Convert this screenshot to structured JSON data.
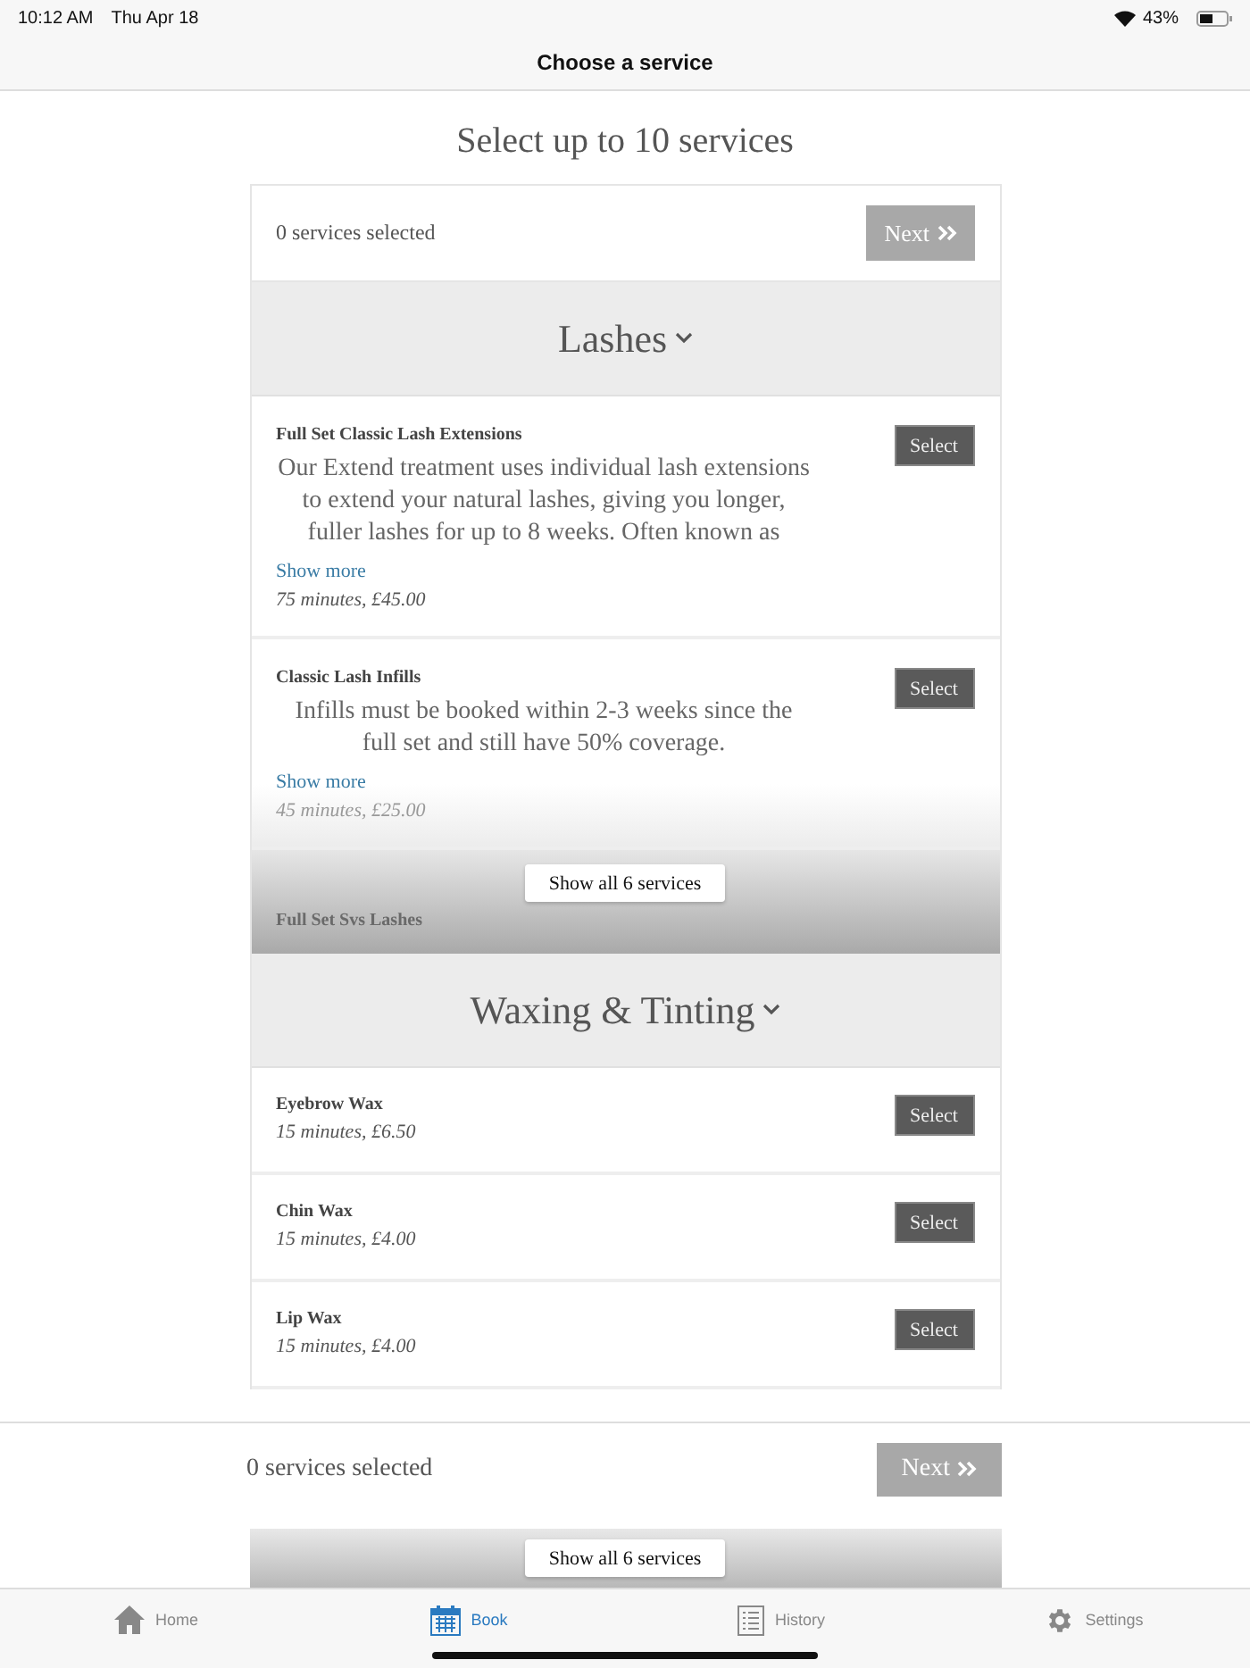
{
  "status_bar": {
    "time": "10:12 AM",
    "date": "Thu Apr 18",
    "battery": "43%"
  },
  "nav": {
    "title": "Choose a service"
  },
  "heading": "Select up to 10 services",
  "summary": {
    "count": "0 services selected",
    "next": "Next",
    "disabled": true
  },
  "sections": [
    {
      "title": "Lashes",
      "expanded": true,
      "services": [
        {
          "name": "Full Set Classic Lash Extensions",
          "description": "Our Extend treatment uses individual lash extensions to extend your natural lashes, giving you longer, fuller lashes for up to 8 weeks. Often known as",
          "show_more": "Show more",
          "details": "75 minutes, £45.00",
          "button": "Select",
          "faded": false
        },
        {
          "name": "Classic Lash Infills",
          "description": "Infills must be booked within 2-3 weeks since the full set and still have 50% coverage.",
          "show_more": "Show more",
          "details": "45 minutes, £25.00",
          "button": "Select",
          "faded": true
        }
      ],
      "show_all": "Show all 6 services",
      "next_hidden_name": "Full Set Svs Lashes"
    },
    {
      "title": "Waxing & Tinting",
      "expanded": true,
      "services": [
        {
          "name": "Eyebrow Wax",
          "details": "15 minutes, £6.50",
          "button": "Select",
          "faded": false
        },
        {
          "name": "Chin Wax",
          "details": "15 minutes, £4.00",
          "button": "Select",
          "faded": false
        },
        {
          "name": "Lip Wax",
          "details": "15 minutes, £4.00",
          "button": "Select",
          "faded": false
        }
      ],
      "show_all": "Show all 6 services"
    }
  ],
  "bottom_bar": {
    "count": "0 services selected",
    "next": "Next",
    "disabled": true
  },
  "tabs": [
    {
      "kind": "home",
      "label": "Home",
      "selected": false
    },
    {
      "kind": "book",
      "label": "Book",
      "selected": true
    },
    {
      "kind": "history",
      "label": "History",
      "selected": false
    },
    {
      "kind": "settings",
      "label": "Settings",
      "selected": false
    }
  ]
}
